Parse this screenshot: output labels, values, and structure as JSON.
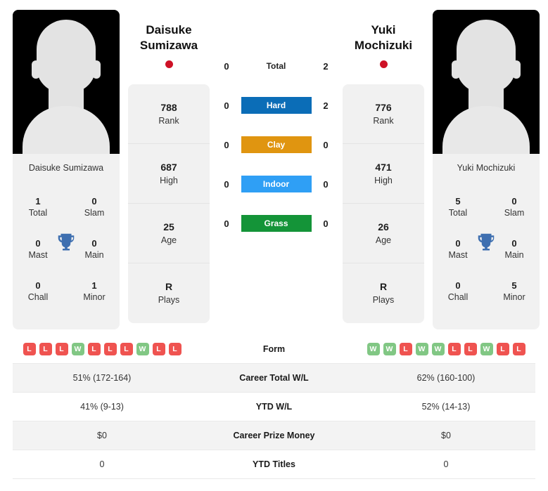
{
  "players": {
    "left": {
      "first_name": "Daisuke",
      "last_name": "Sumizawa",
      "full_name": "Daisuke Sumizawa",
      "flag_color": "#ce1126",
      "rank": "788",
      "rank_label": "Rank",
      "high": "687",
      "high_label": "High",
      "age": "25",
      "age_label": "Age",
      "plays": "R",
      "plays_label": "Plays",
      "titles": {
        "total": "1",
        "total_label": "Total",
        "slam": "0",
        "slam_label": "Slam",
        "mast": "0",
        "mast_label": "Mast",
        "main": "0",
        "main_label": "Main",
        "chall": "0",
        "chall_label": "Chall",
        "minor": "1",
        "minor_label": "Minor"
      },
      "form": [
        "L",
        "L",
        "L",
        "W",
        "L",
        "L",
        "L",
        "W",
        "L",
        "L"
      ],
      "career_wl": "51% (172-164)",
      "ytd_wl": "41% (9-13)",
      "prize_money": "$0",
      "ytd_titles": "0"
    },
    "right": {
      "first_name": "Yuki",
      "last_name": "Mochizuki",
      "full_name": "Yuki Mochizuki",
      "flag_color": "#ce1126",
      "rank": "776",
      "rank_label": "Rank",
      "high": "471",
      "high_label": "High",
      "age": "26",
      "age_label": "Age",
      "plays": "R",
      "plays_label": "Plays",
      "titles": {
        "total": "5",
        "total_label": "Total",
        "slam": "0",
        "slam_label": "Slam",
        "mast": "0",
        "mast_label": "Mast",
        "main": "0",
        "main_label": "Main",
        "chall": "0",
        "chall_label": "Chall",
        "minor": "5",
        "minor_label": "Minor"
      },
      "form": [
        "W",
        "W",
        "L",
        "W",
        "W",
        "L",
        "L",
        "W",
        "L",
        "L"
      ],
      "career_wl": "62% (160-100)",
      "ytd_wl": "52% (14-13)",
      "prize_money": "$0",
      "ytd_titles": "0"
    }
  },
  "head_to_head": [
    {
      "label": "Total",
      "left": "0",
      "right": "2",
      "color": "",
      "badge": false
    },
    {
      "label": "Hard",
      "left": "0",
      "right": "2",
      "color": "#0b6db7",
      "badge": true
    },
    {
      "label": "Clay",
      "left": "0",
      "right": "0",
      "color": "#e09510",
      "badge": true
    },
    {
      "label": "Indoor",
      "left": "0",
      "right": "0",
      "color": "#2f9ff5",
      "badge": true
    },
    {
      "label": "Grass",
      "left": "0",
      "right": "0",
      "color": "#149438",
      "badge": true
    }
  ],
  "table": {
    "form_label": "Form",
    "career_wl_label": "Career Total W/L",
    "ytd_wl_label": "YTD W/L",
    "prize_money_label": "Career Prize Money",
    "ytd_titles_label": "YTD Titles"
  }
}
